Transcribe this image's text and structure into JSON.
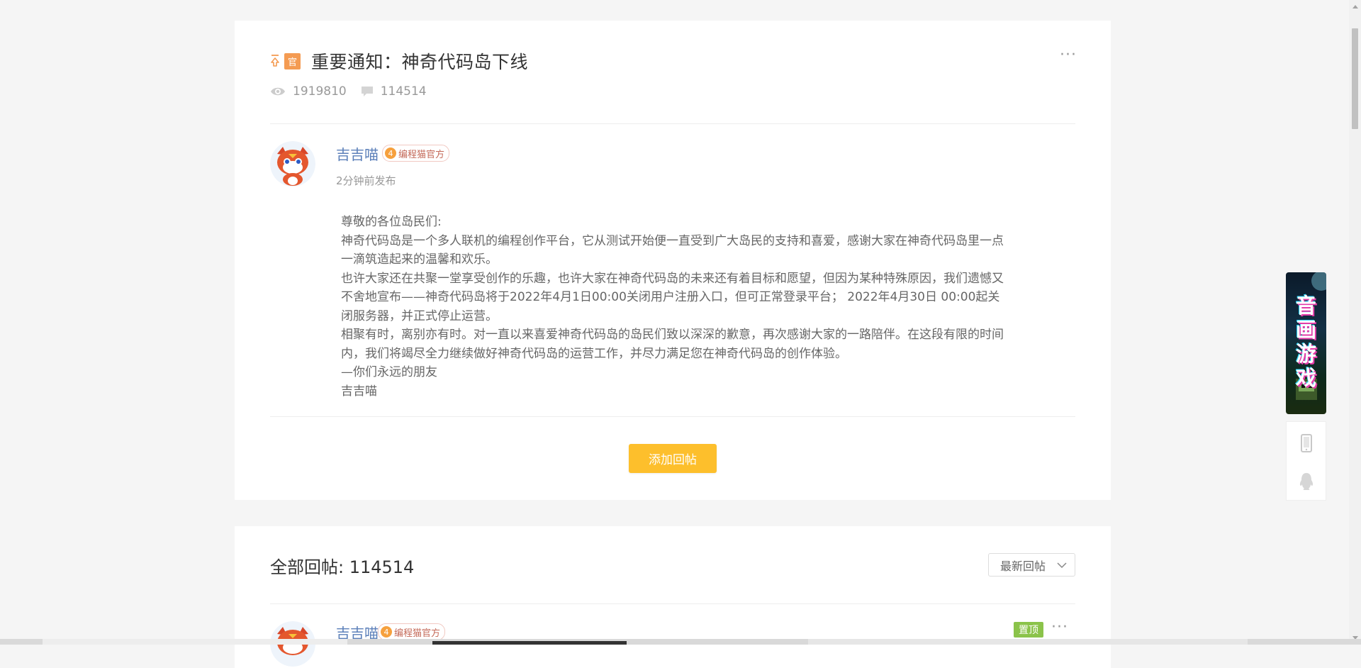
{
  "post": {
    "official_badge": "官",
    "title": "重要通知：神奇代码岛下线",
    "views": "1919810",
    "comments": "114514",
    "more_label": "···",
    "author": {
      "name": "吉吉喵",
      "level": "4",
      "role": "编程猫官方",
      "time": "2分钟前发布"
    },
    "body": [
      "尊敬的各位岛民们:",
      "神奇代码岛是一个多人联机的编程创作平台，它从测试开始便一直受到广大岛民的支持和喜爱，感谢大家在神奇代码岛里一点一滴筑造起来的温馨和欢乐。",
      "也许大家还在共聚一堂享受创作的乐趣，也许大家在神奇代码岛的未来还有着目标和愿望，但因为某种特殊原因，我们遗憾又不舍地宣布——神奇代码岛将于2022年4月1日00:00关闭用户注册入口，但可正常登录平台； 2022年4月30日 00:00起关闭服务器，并正式停止运营。",
      "相聚有时，离别亦有时。对一直以来喜爱神奇代码岛的岛民们致以深深的歉意，再次感谢大家的一路陪伴。在这段有限的时间内，我们将竭尽全力继续做好神奇代码岛的运营工作，并尽力满足您在神奇代码岛的创作体验。",
      "—你们永远的朋友",
      "吉吉喵"
    ],
    "reply_button": "添加回帖"
  },
  "replies": {
    "title": "全部回帖: 114514",
    "sort_label": "最新回帖",
    "first_reply": {
      "author": "吉吉喵",
      "level": "4",
      "role": "编程猫官方",
      "pinned": "置顶",
      "more_label": "···"
    }
  },
  "side": {
    "banner_text": "音画游戏"
  },
  "colors": {
    "accent": "#fdbf2c",
    "author_name": "#5b7fb9",
    "official_badge": "#f49b52",
    "pinned_badge": "#8bc34a"
  }
}
